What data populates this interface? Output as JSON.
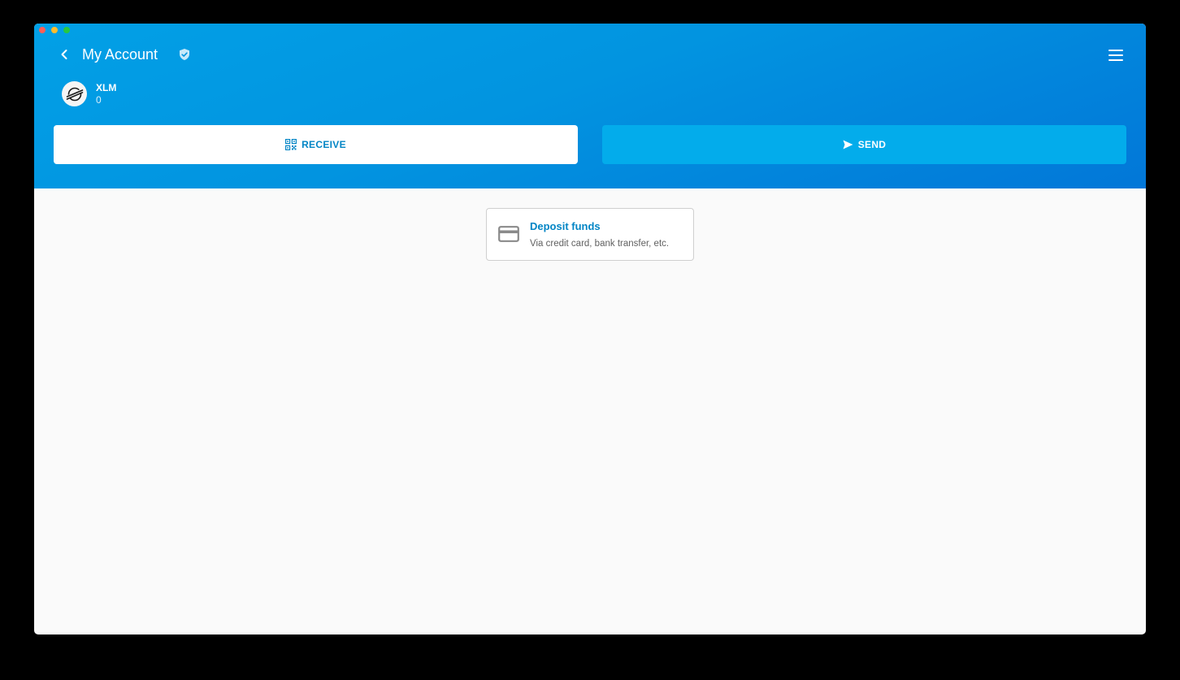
{
  "header": {
    "title": "My Account",
    "back_icon": "chevron-left-icon",
    "verified_icon": "shield-check-icon",
    "menu_icon": "menu-icon",
    "background_color": "#0294e0"
  },
  "asset": {
    "code": "XLM",
    "balance": "0",
    "logo_icon": "stellar-logo-icon"
  },
  "actions": {
    "receive_label": "RECEIVE",
    "receive_icon": "qr-code-icon",
    "send_label": "SEND",
    "send_icon": "send-icon",
    "accent_color": "#0285c5"
  },
  "deposit": {
    "title": "Deposit funds",
    "subtitle": "Via credit card, bank transfer, etc.",
    "icon": "credit-card-icon"
  }
}
